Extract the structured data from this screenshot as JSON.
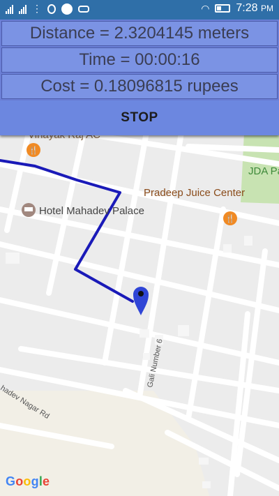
{
  "status_bar": {
    "time": "7:28",
    "ampm": "PM"
  },
  "panel": {
    "distance": "Distance = 2.3204145 meters",
    "time": "Time = 00:00:16",
    "cost": "Cost = 0.18096815 rupees",
    "stop_label": "STOP",
    "accent": "#6b7fd6"
  },
  "map": {
    "labels": {
      "vinayak": "Vinayak Raj AC",
      "jda": "JDA Pa",
      "pradeep": "Pradeep Juice Center",
      "hotel": "Hotel Mahadev Palace",
      "gali": "Gali Number 6",
      "nagar": "hadev Nagar Rd"
    },
    "route_color": "#1a1ab8",
    "marker_color": "#2f45d6",
    "google": [
      "G",
      "o",
      "o",
      "g",
      "l",
      "e"
    ]
  }
}
